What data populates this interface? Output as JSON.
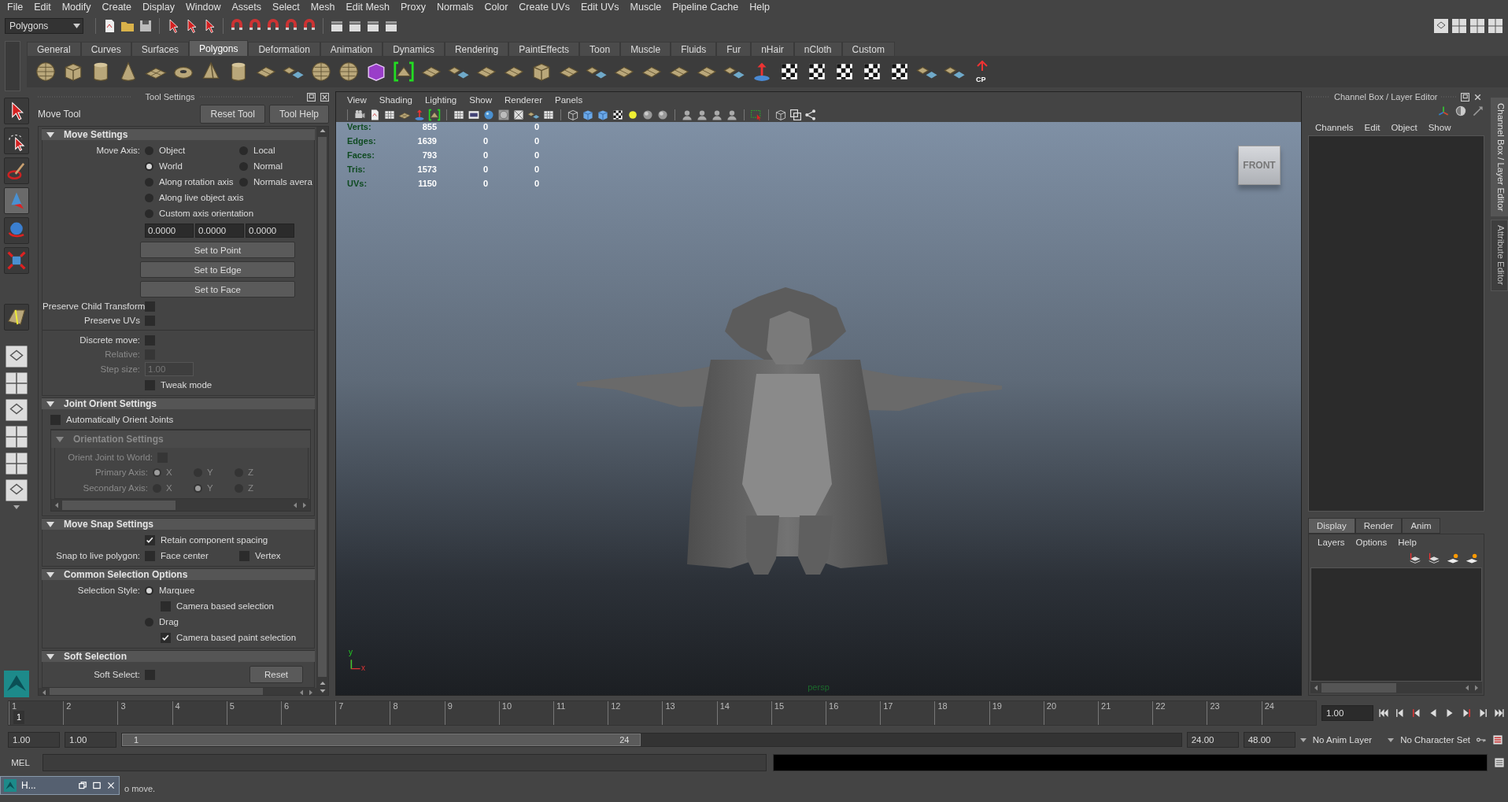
{
  "menu_bar": [
    "File",
    "Edit",
    "Modify",
    "Create",
    "Display",
    "Window",
    "Assets",
    "Select",
    "Mesh",
    "Edit Mesh",
    "Proxy",
    "Normals",
    "Color",
    "Create UVs",
    "Edit UVs",
    "Muscle",
    "Pipeline Cache",
    "Help"
  ],
  "status_line": {
    "mode": "Polygons"
  },
  "shelf": {
    "tabs": [
      {
        "label": "General",
        "selected": false
      },
      {
        "label": "Curves",
        "selected": false
      },
      {
        "label": "Surfaces",
        "selected": false
      },
      {
        "label": "Polygons",
        "selected": true
      },
      {
        "label": "Deformation",
        "selected": false
      },
      {
        "label": "Animation",
        "selected": false
      },
      {
        "label": "Dynamics",
        "selected": false
      },
      {
        "label": "Rendering",
        "selected": false
      },
      {
        "label": "PaintEffects",
        "selected": false
      },
      {
        "label": "Toon",
        "selected": false
      },
      {
        "label": "Muscle",
        "selected": false
      },
      {
        "label": "Fluids",
        "selected": false
      },
      {
        "label": "Fur",
        "selected": false
      },
      {
        "label": "nHair",
        "selected": false
      },
      {
        "label": "nCloth",
        "selected": false
      },
      {
        "label": "Custom",
        "selected": false
      }
    ],
    "badge": "CP"
  },
  "tool_settings": {
    "title": "Tool Settings",
    "tool_name": "Move Tool",
    "buttons": [
      "Reset Tool",
      "Tool Help"
    ],
    "sections": [
      {
        "title": "Move Settings",
        "expanded": true,
        "rows": [
          {
            "kind": "options",
            "label": "Move Axis:",
            "items": [
              {
                "kind": "radio",
                "label": "Object",
                "selected": false
              },
              {
                "kind": "radio",
                "label": "Local",
                "selected": false
              }
            ]
          },
          {
            "kind": "options",
            "items": [
              {
                "kind": "radio",
                "label": "World",
                "selected": true
              },
              {
                "kind": "radio",
                "label": "Normal",
                "selected": false
              }
            ]
          },
          {
            "kind": "options",
            "items": [
              {
                "kind": "radio",
                "label": "Along rotation axis",
                "selected": false
              },
              {
                "kind": "radio",
                "label": "Normals avera",
                "selected": false
              }
            ]
          },
          {
            "kind": "options",
            "items": [
              {
                "kind": "radio",
                "label": "Along live object axis",
                "selected": false
              }
            ]
          },
          {
            "kind": "options",
            "items": [
              {
                "kind": "radio",
                "label": "Custom axis orientation",
                "selected": false
              }
            ]
          },
          {
            "kind": "fields",
            "values": [
              "0.0000",
              "0.0000",
              "0.0000"
            ]
          },
          {
            "kind": "button",
            "label": "Set to Point"
          },
          {
            "kind": "button",
            "label": "Set to Edge"
          },
          {
            "kind": "button",
            "label": "Set to Face"
          },
          {
            "kind": "check",
            "label": "Preserve Child Transform",
            "checked": false
          },
          {
            "kind": "check",
            "label": "Preserve UVs",
            "checked": false
          },
          {
            "kind": "divider"
          },
          {
            "kind": "check",
            "label": "Discrete move:",
            "checked": false
          },
          {
            "kind": "check",
            "label": "Relative:",
            "checked": false,
            "disabled": true
          },
          {
            "kind": "field",
            "label": "Step size:",
            "value": "1.00",
            "disabled": true
          },
          {
            "kind": "options",
            "items": [
              {
                "kind": "check",
                "label": "Tweak mode",
                "checked": false
              }
            ]
          }
        ]
      },
      {
        "title": "Joint Orient Settings",
        "expanded": true,
        "rows": [
          {
            "kind": "wide_check",
            "label": "Automatically Orient Joints",
            "checked": false
          },
          {
            "kind": "subsection",
            "title": "Orientation Settings",
            "disabled": true,
            "rows": [
              {
                "kind": "check",
                "label": "Orient Joint to World:",
                "checked": false
              },
              {
                "kind": "axes",
                "label": "Primary Axis:",
                "items": [
                  {
                    "label": "X",
                    "selected": true
                  },
                  {
                    "label": "Y",
                    "selected": false
                  },
                  {
                    "label": "Z",
                    "selected": false
                  }
                ]
              },
              {
                "kind": "axes",
                "label": "Secondary Axis:",
                "items": [
                  {
                    "label": "X",
                    "selected": false
                  },
                  {
                    "label": "Y",
                    "selected": true
                  },
                  {
                    "label": "Z",
                    "selected": false
                  }
                ]
              }
            ]
          }
        ]
      },
      {
        "title": "Move Snap Settings",
        "expanded": true,
        "rows": [
          {
            "kind": "options",
            "items": [
              {
                "kind": "check",
                "label": "Retain component spacing",
                "checked": true
              }
            ]
          },
          {
            "kind": "options",
            "label": "Snap to live polygon:",
            "items": [
              {
                "kind": "check",
                "label": "Face center",
                "checked": false
              },
              {
                "kind": "check",
                "label": "Vertex",
                "checked": false
              }
            ]
          }
        ]
      },
      {
        "title": "Common Selection Options",
        "expanded": true,
        "rows": [
          {
            "kind": "options",
            "label": "Selection Style:",
            "items": [
              {
                "kind": "radio",
                "label": "Marquee",
                "selected": true
              }
            ]
          },
          {
            "kind": "options",
            "indent": true,
            "items": [
              {
                "kind": "check",
                "label": "Camera based selection",
                "checked": false
              }
            ]
          },
          {
            "kind": "options",
            "items": [
              {
                "kind": "radio",
                "label": "Drag",
                "selected": false
              }
            ]
          },
          {
            "kind": "options",
            "indent": true,
            "items": [
              {
                "kind": "check",
                "label": "Camera based paint selection",
                "checked": true
              }
            ]
          }
        ]
      },
      {
        "title": "Soft Selection",
        "expanded": true,
        "rows": [
          {
            "kind": "check_button",
            "label": "Soft Select:",
            "checked": false,
            "button": "Reset"
          }
        ]
      }
    ]
  },
  "viewport": {
    "menu": [
      "View",
      "Shading",
      "Lighting",
      "Show",
      "Renderer",
      "Panels"
    ],
    "stats": [
      {
        "label": "Verts:",
        "values": [
          "855",
          "0",
          "0"
        ]
      },
      {
        "label": "Edges:",
        "values": [
          "1639",
          "0",
          "0"
        ]
      },
      {
        "label": "Faces:",
        "values": [
          "793",
          "0",
          "0"
        ]
      },
      {
        "label": "Tris:",
        "values": [
          "1573",
          "0",
          "0"
        ]
      },
      {
        "label": "UVs:",
        "values": [
          "1150",
          "0",
          "0"
        ]
      }
    ],
    "view_cube": "FRONT",
    "camera": "persp",
    "axes": [
      "y",
      "x"
    ]
  },
  "channel_box": {
    "title": "Channel Box / Layer Editor",
    "menu": [
      "Channels",
      "Edit",
      "Object",
      "Show"
    ],
    "layer_tabs": [
      {
        "label": "Display",
        "selected": true
      },
      {
        "label": "Render",
        "selected": false
      },
      {
        "label": "Anim",
        "selected": false
      }
    ],
    "layer_menu": [
      "Layers",
      "Options",
      "Help"
    ]
  },
  "side_tabs": [
    {
      "label": "Channel Box / Layer Editor",
      "selected": true
    },
    {
      "label": "Attribute Editor",
      "selected": false
    }
  ],
  "timeline": {
    "ticks": [
      "1",
      "2",
      "3",
      "4",
      "5",
      "6",
      "7",
      "8",
      "9",
      "10",
      "11",
      "12",
      "13",
      "14",
      "15",
      "16",
      "17",
      "18",
      "19",
      "20",
      "21",
      "22",
      "23",
      "24"
    ],
    "current_frame": "1",
    "frame_field": "1.00"
  },
  "range": {
    "start": "1.00",
    "playback_start": "1.00",
    "slider_start": "1",
    "slider_end": "24",
    "level": 0.49,
    "playback_end": "24.00",
    "end": "48.00",
    "anim_layer": "No Anim Layer",
    "character_set": "No Character Set"
  },
  "command_line": {
    "label": "MEL"
  },
  "help_line": {
    "window_title": "H...",
    "text": "o move."
  }
}
